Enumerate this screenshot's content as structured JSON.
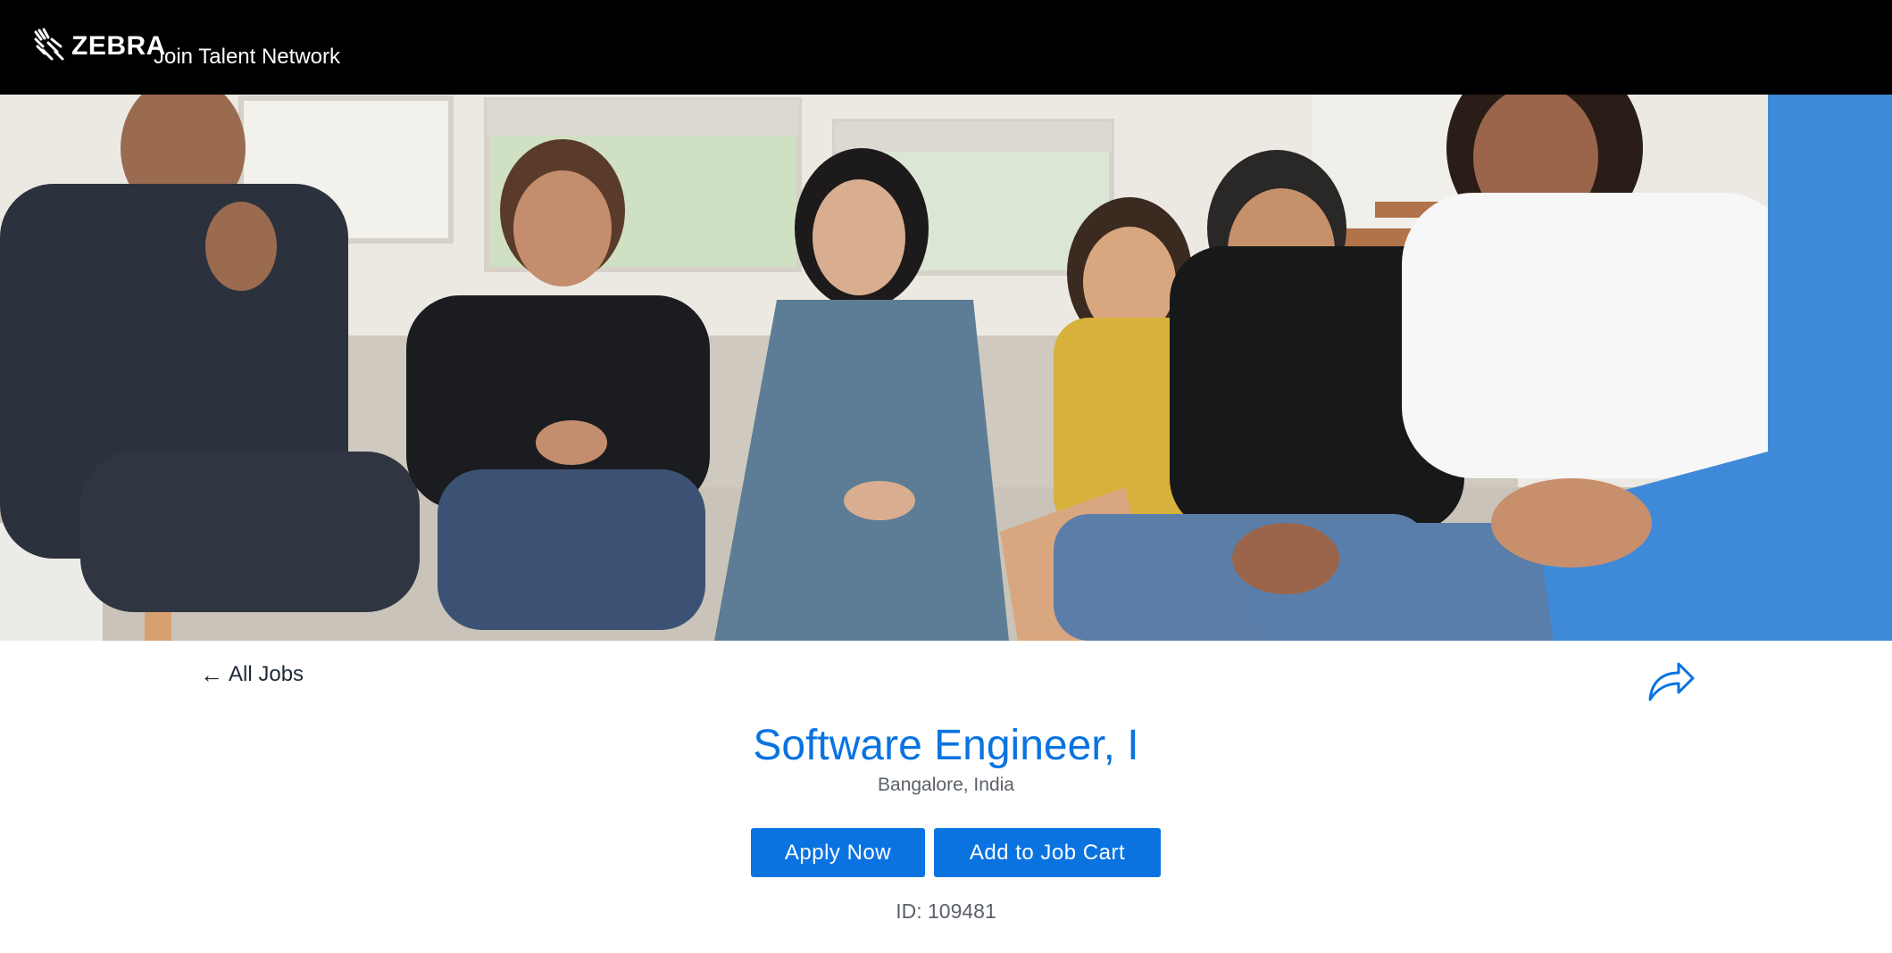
{
  "header": {
    "brand": "ZEBRA",
    "talent_network_label": "Join Talent Network"
  },
  "navigation": {
    "back_label": "All Jobs"
  },
  "job": {
    "title": "Software Engineer, I",
    "location": "Bangalore, India",
    "id_label": "ID: 109481"
  },
  "actions": {
    "apply_label": "Apply Now",
    "cart_label": "Add to Job Cart"
  },
  "icons": {
    "logo": "zebra-head-icon",
    "back": "arrow-left-icon",
    "share": "share-arrow-icon"
  },
  "colors": {
    "header_bg": "#000000",
    "accent": "#0a73e0",
    "muted_text": "#5b6168"
  }
}
